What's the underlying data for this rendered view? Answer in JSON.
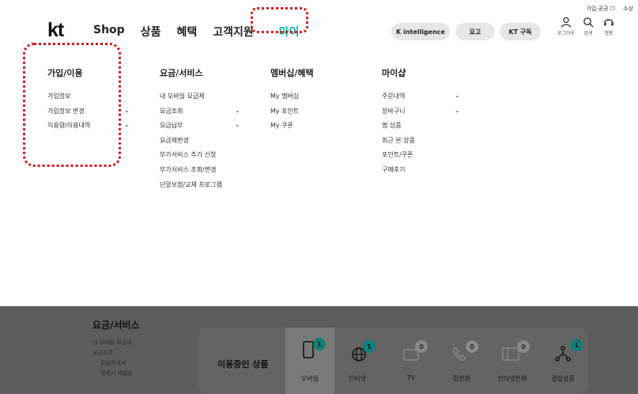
{
  "util_links": [
    "가입·공공 ☐",
    "소상"
  ],
  "logo": "kt",
  "gnb": [
    "Shop",
    "상품",
    "혜택",
    "고객지원",
    "마이"
  ],
  "pills": [
    "K intelligence",
    "요고",
    "KT 구독"
  ],
  "icons": {
    "login": "로그아웃",
    "search": "검색",
    "chat": "챗봇"
  },
  "menu": {
    "col1": {
      "title": "가입/이용",
      "items": [
        "가입정보",
        "가입정보 변경",
        "이용량/이용내역"
      ]
    },
    "col2": {
      "title": "요금/서비스",
      "items": [
        "내 모바일 요금제",
        "요금조회",
        "요금납부",
        "요금제변경",
        "부가서비스 추가 신청",
        "부가서비스 조회/변경",
        "단말보험/교체 프로그램"
      ]
    },
    "col3": {
      "title": "멤버십/혜택",
      "items": [
        "My 멤버십",
        "My 포인트",
        "My 쿠폰"
      ]
    },
    "col4": {
      "title": "마이샵",
      "items": [
        "주문내역",
        "장바구니",
        "찜 상품",
        "최근 본 상품",
        "포인트/쿠폰",
        "구매후기"
      ]
    }
  },
  "bg": {
    "section_title": "요금/서비스",
    "sub": [
      "내 모바일 요금제",
      "요금조회",
      "요금명세서",
      "명세서 재발송"
    ],
    "products_title": "이용중인 상품",
    "products": [
      {
        "label": "모바일",
        "count": "1"
      },
      {
        "label": "인터넷",
        "count": "1"
      },
      {
        "label": "TV",
        "count": "0"
      },
      {
        "label": "집전화",
        "count": "0"
      },
      {
        "label": "인터넷전화",
        "count": "0"
      },
      {
        "label": "결합상품",
        "count": "1"
      }
    ]
  }
}
